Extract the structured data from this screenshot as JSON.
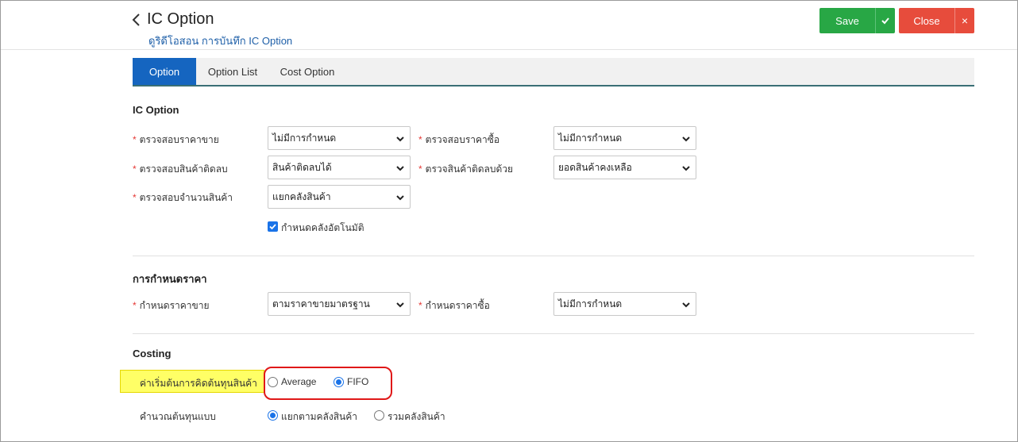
{
  "header": {
    "title": "IC Option",
    "subtitle": "ดูริดีโอสอน การบันทึก IC Option",
    "save_label": "Save",
    "close_label": "Close",
    "close_x": "×"
  },
  "tabs": [
    {
      "label": "Option",
      "active": true
    },
    {
      "label": "Option List",
      "active": false
    },
    {
      "label": "Cost Option",
      "active": false
    }
  ],
  "ic_option": {
    "title": "IC Option",
    "fields": [
      {
        "label": "ตรวจสอบราคาขาย",
        "value": "ไม่มีการกำหนด",
        "required": true
      },
      {
        "label": "ตรวจสอบราคาซื้อ",
        "value": "ไม่มีการกำหนด",
        "required": true
      },
      {
        "label": "ตรวจสอบสินค้าติดลบ",
        "value": "สินค้าติดลบได้",
        "required": true
      },
      {
        "label": "ตรวจสินค้าติดลบด้วย",
        "value": "ยอดสินค้าคงเหลือ",
        "required": true
      },
      {
        "label": "ตรวจสอบจำนวนสินค้า",
        "value": "แยกคลังสินค้า",
        "required": true
      }
    ],
    "auto_warehouse": {
      "label": "กำหนดคลังอัตโนมัติ",
      "checked": true
    }
  },
  "pricing": {
    "title": "การกำหนดราคา",
    "fields": [
      {
        "label": "กำหนดราคาขาย",
        "value": "ตามราคาขายมาตรฐาน",
        "required": true
      },
      {
        "label": "กำหนดราคาซื้อ",
        "value": "ไม่มีการกำหนด",
        "required": true
      }
    ]
  },
  "costing": {
    "title": "Costing",
    "method_label": "ค่าเริ่มต้นการคิดต้นทุนสินค้า",
    "method_options": [
      "Average",
      "FIFO"
    ],
    "method_selected": "FIFO",
    "calc_label": "คำนวณต้นทุนแบบ",
    "calc_options": [
      "แยกตามคลังสินค้า",
      "รวมคลังสินค้า"
    ],
    "calc_selected": "แยกตามคลังสินค้า"
  },
  "colors": {
    "save": "#28a745",
    "close": "#e74c3c",
    "active_tab": "#1565c0",
    "required": "#e53935",
    "highlight": "#ffff66",
    "annotation": "#e01818"
  }
}
